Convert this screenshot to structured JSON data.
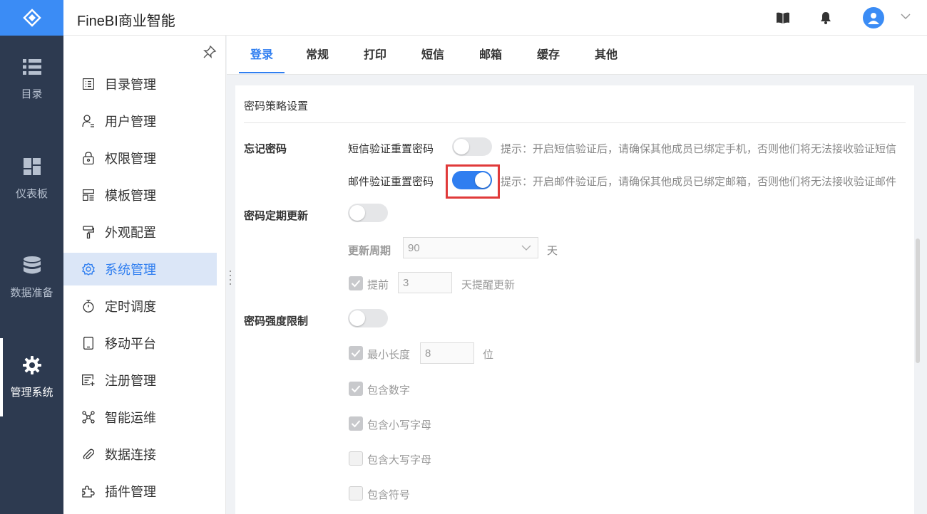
{
  "app": {
    "title": "FineBI商业智能"
  },
  "rail": {
    "items": [
      {
        "label": "目录",
        "icon": "list-icon"
      },
      {
        "label": "仪表板",
        "icon": "dashboard-icon"
      },
      {
        "label": "数据准备",
        "icon": "database-icon"
      },
      {
        "label": "管理系统",
        "icon": "gear-icon",
        "active": true
      }
    ]
  },
  "menu": {
    "items": [
      {
        "label": "目录管理",
        "icon": "catalog-icon"
      },
      {
        "label": "用户管理",
        "icon": "user-icon"
      },
      {
        "label": "权限管理",
        "icon": "lock-icon"
      },
      {
        "label": "模板管理",
        "icon": "template-icon"
      },
      {
        "label": "外观配置",
        "icon": "paint-roller-icon"
      },
      {
        "label": "系统管理",
        "icon": "settings-icon",
        "active": true
      },
      {
        "label": "定时调度",
        "icon": "timer-icon"
      },
      {
        "label": "移动平台",
        "icon": "tablet-icon"
      },
      {
        "label": "注册管理",
        "icon": "register-icon"
      },
      {
        "label": "智能运维",
        "icon": "network-icon"
      },
      {
        "label": "数据连接",
        "icon": "paperclip-icon"
      },
      {
        "label": "插件管理",
        "icon": "puzzle-icon"
      }
    ]
  },
  "tabs": [
    {
      "label": "登录",
      "active": true
    },
    {
      "label": "常规"
    },
    {
      "label": "打印"
    },
    {
      "label": "短信"
    },
    {
      "label": "邮箱"
    },
    {
      "label": "缓存"
    },
    {
      "label": "其他"
    }
  ],
  "content": {
    "section_title": "密码策略设置",
    "forgot_password": {
      "label": "忘记密码",
      "sms_reset_label": "短信验证重置密码",
      "sms_reset_on": false,
      "sms_hint": "提示：开启短信验证后，请确保其他成员已绑定手机，否则他们将无法接收验证短信",
      "email_reset_label": "邮件验证重置密码",
      "email_reset_on": true,
      "email_hint": "提示：开启邮件验证后，请确保其他成员已绑定邮箱，否则他们将无法接收验证邮件"
    },
    "periodic_update": {
      "label": "密码定期更新",
      "enabled": false,
      "period_label": "更新周期",
      "period_value": "90",
      "period_unit": "天",
      "advance_label": "提前",
      "advance_checked": true,
      "advance_value": "3",
      "advance_suffix": "天提醒更新"
    },
    "strength": {
      "label": "密码强度限制",
      "enabled": false,
      "min_length_label": "最小长度",
      "min_length_value": "8",
      "min_length_unit": "位",
      "rules": [
        {
          "label": "包含数字",
          "checked": true
        },
        {
          "label": "包含小写字母",
          "checked": true
        },
        {
          "label": "包含大写字母",
          "checked": false
        },
        {
          "label": "包含符号",
          "checked": false
        }
      ]
    }
  },
  "colors": {
    "accent": "#2f7ef0",
    "rail_bg": "#2d3a50",
    "logo_bg": "#3b8cf5",
    "highlight": "#e03a3a"
  }
}
